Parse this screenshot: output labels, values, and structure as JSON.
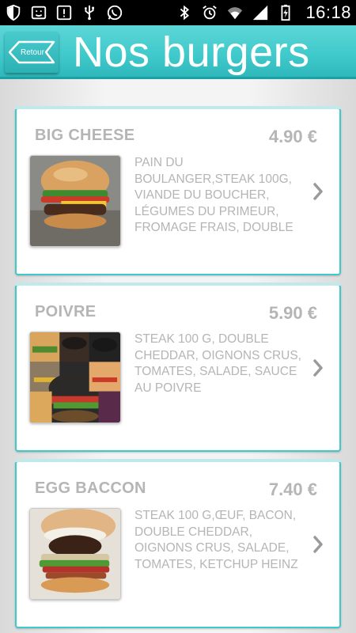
{
  "status_bar": {
    "time": "16:18",
    "left_icons": [
      "shield-icon",
      "face-icon",
      "alert-icon",
      "usb-icon",
      "whatsapp-icon"
    ],
    "right_icons": [
      "bluetooth-icon",
      "alarm-icon",
      "wifi-icon",
      "signal-icon",
      "battery-icon"
    ]
  },
  "header": {
    "back_label": "Retour",
    "title": "Nos burgers",
    "accent_color": "#3fc9cb"
  },
  "burgers": [
    {
      "name": "BIG CHEESE",
      "price": "4.90 €",
      "description": "PAIN DU BOULANGER,STEAK 100G, VIANDE DU BOUCHER, LÉGUMES DU PRIMEUR, FROMAGE FRAIS, DOUBLE"
    },
    {
      "name": "POIVRE",
      "price": "5.90 €",
      "description": "STEAK 100 G, DOUBLE CHEDDAR, OIGNONS CRUS, TOMATES, SALADE, SAUCE AU POIVRE"
    },
    {
      "name": "EGG BACCON",
      "price": "7.40 €",
      "description": "STEAK 100 G,ŒUF, BACON, DOUBLE CHEDDAR, OIGNONS CRUS, SALADE, TOMATES, KETCHUP HEINZ"
    }
  ]
}
